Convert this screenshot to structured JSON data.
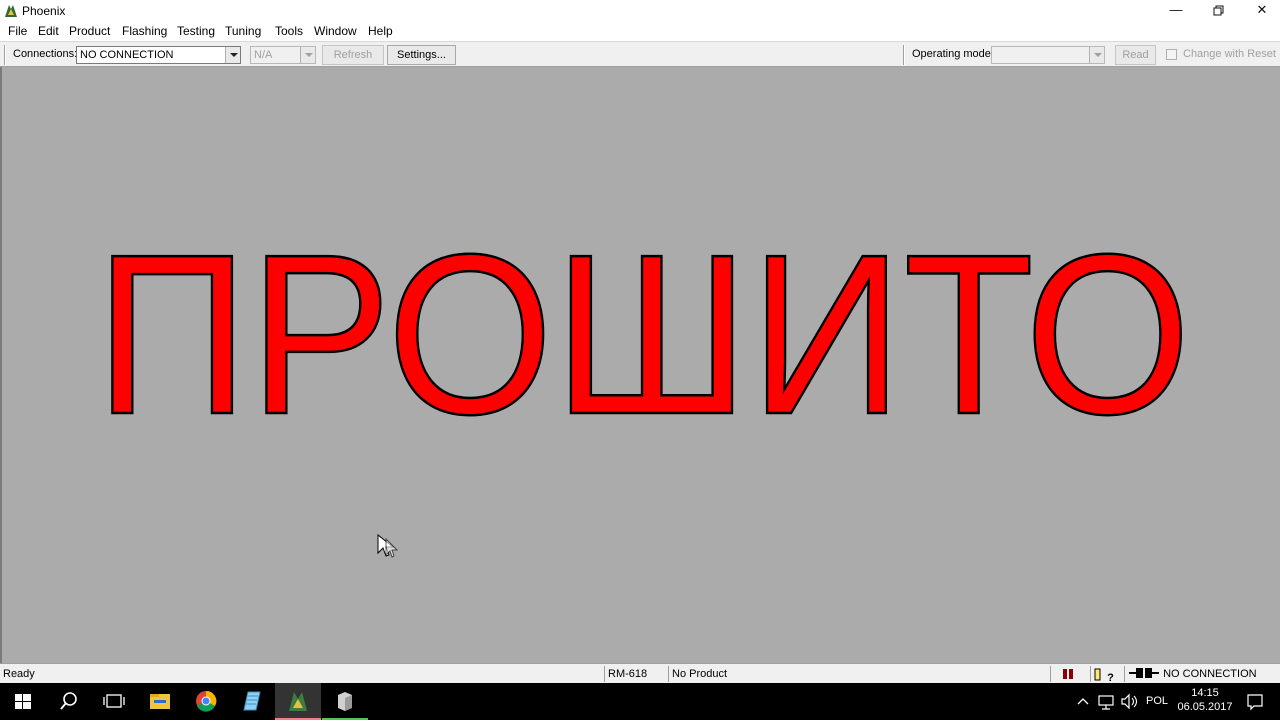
{
  "window": {
    "title": "Phoenix",
    "icon": "phoenix-app-icon",
    "controls": {
      "minimize": "minimize-icon",
      "restore": "restore-icon",
      "close": "close-icon"
    }
  },
  "menu": [
    "File",
    "Edit",
    "Product",
    "Flashing",
    "Testing",
    "Tuning",
    "Tools",
    "Window",
    "Help"
  ],
  "toolbar": {
    "connections_label": "Connections:",
    "connection_value": "NO CONNECTION",
    "na_value": "N/A",
    "refresh_label": "Refresh",
    "settings_label": "Settings...",
    "operating_mode_label": "Operating mode:",
    "operating_mode_value": "",
    "read_label": "Read",
    "change_with_reset_label": "Change with Reset",
    "change_with_reset_checked": false
  },
  "main": {
    "overlay_text": "ПРОШИТО",
    "overlay_color": "#ff0000",
    "background_color": "#ababab"
  },
  "status": {
    "ready": "Ready",
    "model": "RM-618",
    "product": "No Product",
    "connection": "NO CONNECTION"
  },
  "taskbar": {
    "apps": [
      "windows-start-icon",
      "search-icon",
      "task-view-icon",
      "file-explorer-icon",
      "chrome-icon",
      "app-icon-blue",
      "phoenix-icon",
      "app-icon-box"
    ],
    "active_app": "phoenix-icon",
    "language": "POL",
    "time": "14:15",
    "date": "06.05.2017"
  }
}
